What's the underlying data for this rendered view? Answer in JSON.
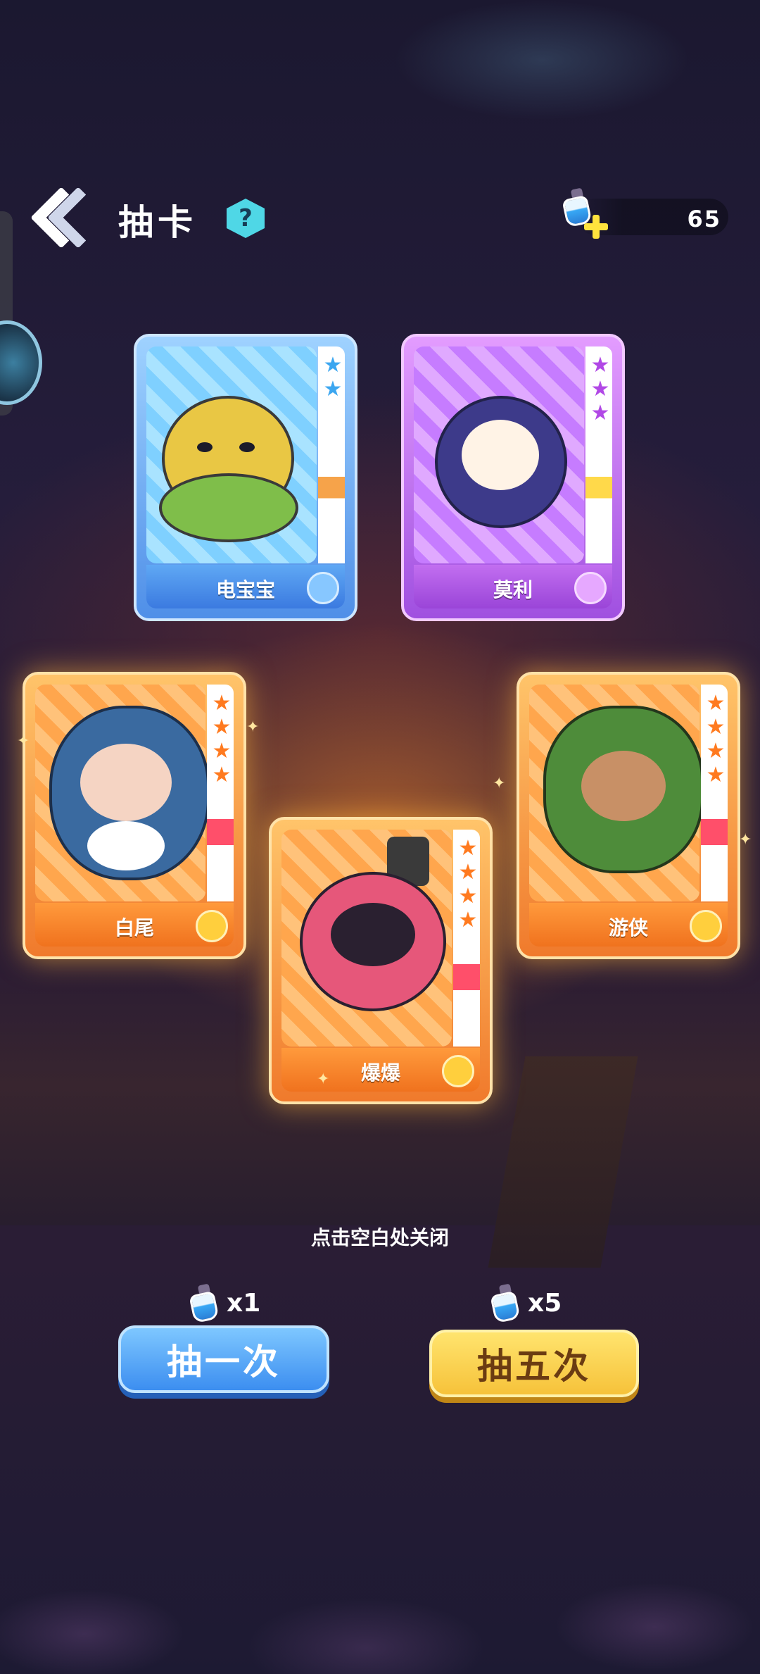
{
  "header": {
    "title": "抽卡",
    "help_label": "?",
    "currency_amount": "65"
  },
  "cards": [
    {
      "name": "电宝宝",
      "rarity": "blue",
      "stars": 2
    },
    {
      "name": "莫利",
      "rarity": "purple",
      "stars": 3
    },
    {
      "name": "白尾",
      "rarity": "orange",
      "stars": 4
    },
    {
      "name": "爆爆",
      "rarity": "orange",
      "stars": 4
    },
    {
      "name": "游侠",
      "rarity": "orange",
      "stars": 4
    }
  ],
  "hint": "点击空白处关闭",
  "draw_one": {
    "label": "抽一次",
    "cost": "x1"
  },
  "draw_five": {
    "label": "抽五次",
    "cost": "x5"
  },
  "colors": {
    "blue_button": "#4a9cf2",
    "yellow_button": "#f8d14c",
    "help_badge": "#4fd7e6"
  }
}
